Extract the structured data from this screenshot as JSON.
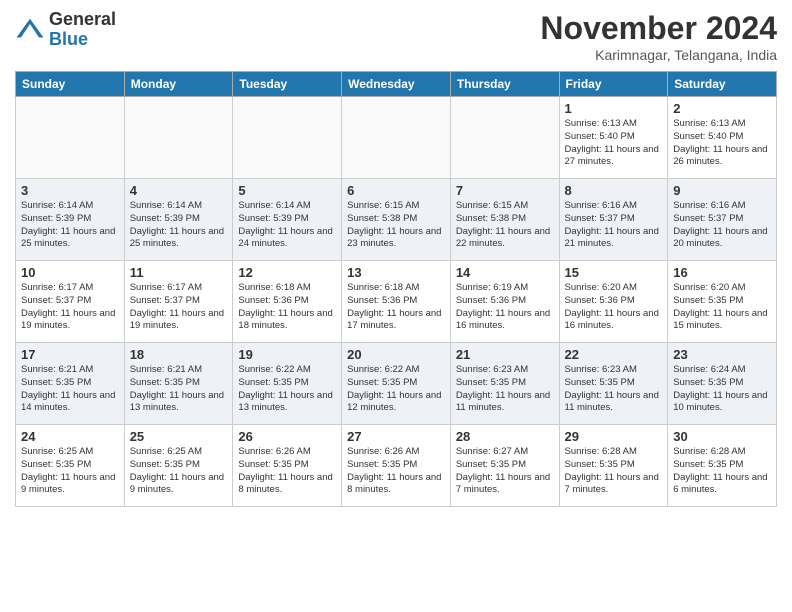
{
  "logo": {
    "general": "General",
    "blue": "Blue"
  },
  "title": "November 2024",
  "location": "Karimnagar, Telangana, India",
  "weekdays": [
    "Sunday",
    "Monday",
    "Tuesday",
    "Wednesday",
    "Thursday",
    "Friday",
    "Saturday"
  ],
  "weeks": [
    [
      {
        "day": "",
        "info": ""
      },
      {
        "day": "",
        "info": ""
      },
      {
        "day": "",
        "info": ""
      },
      {
        "day": "",
        "info": ""
      },
      {
        "day": "",
        "info": ""
      },
      {
        "day": "1",
        "info": "Sunrise: 6:13 AM\nSunset: 5:40 PM\nDaylight: 11 hours and 27 minutes."
      },
      {
        "day": "2",
        "info": "Sunrise: 6:13 AM\nSunset: 5:40 PM\nDaylight: 11 hours and 26 minutes."
      }
    ],
    [
      {
        "day": "3",
        "info": "Sunrise: 6:14 AM\nSunset: 5:39 PM\nDaylight: 11 hours and 25 minutes."
      },
      {
        "day": "4",
        "info": "Sunrise: 6:14 AM\nSunset: 5:39 PM\nDaylight: 11 hours and 25 minutes."
      },
      {
        "day": "5",
        "info": "Sunrise: 6:14 AM\nSunset: 5:39 PM\nDaylight: 11 hours and 24 minutes."
      },
      {
        "day": "6",
        "info": "Sunrise: 6:15 AM\nSunset: 5:38 PM\nDaylight: 11 hours and 23 minutes."
      },
      {
        "day": "7",
        "info": "Sunrise: 6:15 AM\nSunset: 5:38 PM\nDaylight: 11 hours and 22 minutes."
      },
      {
        "day": "8",
        "info": "Sunrise: 6:16 AM\nSunset: 5:37 PM\nDaylight: 11 hours and 21 minutes."
      },
      {
        "day": "9",
        "info": "Sunrise: 6:16 AM\nSunset: 5:37 PM\nDaylight: 11 hours and 20 minutes."
      }
    ],
    [
      {
        "day": "10",
        "info": "Sunrise: 6:17 AM\nSunset: 5:37 PM\nDaylight: 11 hours and 19 minutes."
      },
      {
        "day": "11",
        "info": "Sunrise: 6:17 AM\nSunset: 5:37 PM\nDaylight: 11 hours and 19 minutes."
      },
      {
        "day": "12",
        "info": "Sunrise: 6:18 AM\nSunset: 5:36 PM\nDaylight: 11 hours and 18 minutes."
      },
      {
        "day": "13",
        "info": "Sunrise: 6:18 AM\nSunset: 5:36 PM\nDaylight: 11 hours and 17 minutes."
      },
      {
        "day": "14",
        "info": "Sunrise: 6:19 AM\nSunset: 5:36 PM\nDaylight: 11 hours and 16 minutes."
      },
      {
        "day": "15",
        "info": "Sunrise: 6:20 AM\nSunset: 5:36 PM\nDaylight: 11 hours and 16 minutes."
      },
      {
        "day": "16",
        "info": "Sunrise: 6:20 AM\nSunset: 5:35 PM\nDaylight: 11 hours and 15 minutes."
      }
    ],
    [
      {
        "day": "17",
        "info": "Sunrise: 6:21 AM\nSunset: 5:35 PM\nDaylight: 11 hours and 14 minutes."
      },
      {
        "day": "18",
        "info": "Sunrise: 6:21 AM\nSunset: 5:35 PM\nDaylight: 11 hours and 13 minutes."
      },
      {
        "day": "19",
        "info": "Sunrise: 6:22 AM\nSunset: 5:35 PM\nDaylight: 11 hours and 13 minutes."
      },
      {
        "day": "20",
        "info": "Sunrise: 6:22 AM\nSunset: 5:35 PM\nDaylight: 11 hours and 12 minutes."
      },
      {
        "day": "21",
        "info": "Sunrise: 6:23 AM\nSunset: 5:35 PM\nDaylight: 11 hours and 11 minutes."
      },
      {
        "day": "22",
        "info": "Sunrise: 6:23 AM\nSunset: 5:35 PM\nDaylight: 11 hours and 11 minutes."
      },
      {
        "day": "23",
        "info": "Sunrise: 6:24 AM\nSunset: 5:35 PM\nDaylight: 11 hours and 10 minutes."
      }
    ],
    [
      {
        "day": "24",
        "info": "Sunrise: 6:25 AM\nSunset: 5:35 PM\nDaylight: 11 hours and 9 minutes."
      },
      {
        "day": "25",
        "info": "Sunrise: 6:25 AM\nSunset: 5:35 PM\nDaylight: 11 hours and 9 minutes."
      },
      {
        "day": "26",
        "info": "Sunrise: 6:26 AM\nSunset: 5:35 PM\nDaylight: 11 hours and 8 minutes."
      },
      {
        "day": "27",
        "info": "Sunrise: 6:26 AM\nSunset: 5:35 PM\nDaylight: 11 hours and 8 minutes."
      },
      {
        "day": "28",
        "info": "Sunrise: 6:27 AM\nSunset: 5:35 PM\nDaylight: 11 hours and 7 minutes."
      },
      {
        "day": "29",
        "info": "Sunrise: 6:28 AM\nSunset: 5:35 PM\nDaylight: 11 hours and 7 minutes."
      },
      {
        "day": "30",
        "info": "Sunrise: 6:28 AM\nSunset: 5:35 PM\nDaylight: 11 hours and 6 minutes."
      }
    ]
  ]
}
